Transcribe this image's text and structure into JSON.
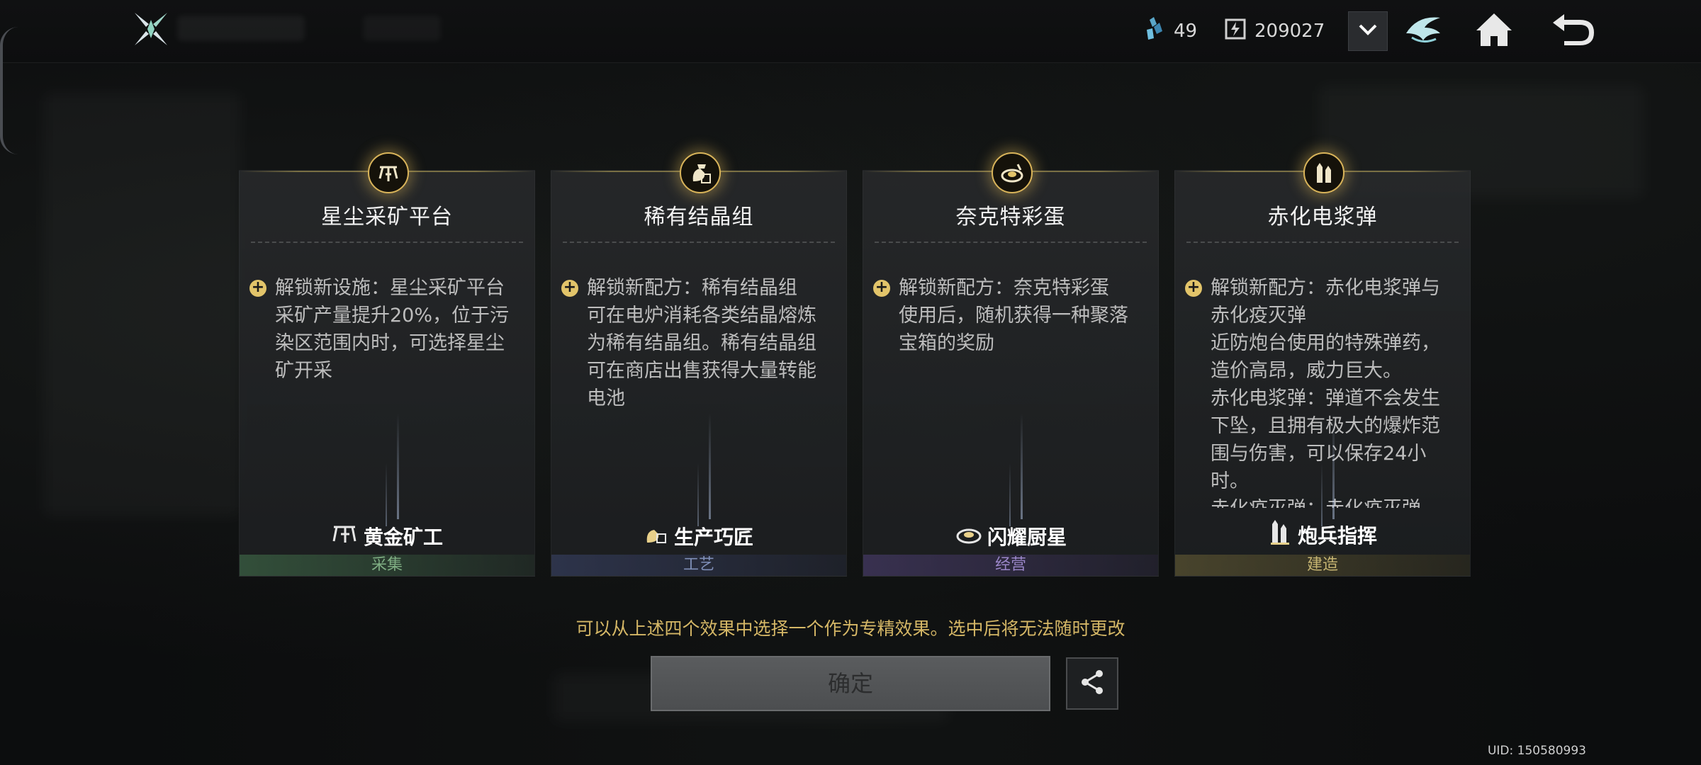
{
  "header": {
    "resources": [
      {
        "icon": "crystal-shard-icon",
        "value": "49"
      },
      {
        "icon": "energy-cell-icon",
        "value": "209027"
      }
    ]
  },
  "cards": [
    {
      "icon": "mining-platform-icon",
      "title": "星尘采矿平台",
      "description": [
        "解锁新设施：星尘采矿平台",
        "采矿产量提升20%，位于污染区范围内时，可选择星尘矿开采"
      ],
      "subtitle": "黄金矿工",
      "subtitle_icon": "mining-platform-icon",
      "category": "采集",
      "accent": "#7fae83"
    },
    {
      "icon": "crystal-cluster-icon",
      "title": "稀有结晶组",
      "description": [
        "解锁新配方：稀有结晶组",
        "可在电炉消耗各类结晶熔炼为稀有结晶组。稀有结晶组可在商店出售获得大量转能电池"
      ],
      "subtitle": "生产巧匠",
      "subtitle_icon": "crystal-cluster-icon",
      "category": "工艺",
      "accent": "#7f8fb8"
    },
    {
      "icon": "egg-dish-icon",
      "title": "奈克特彩蛋",
      "description": [
        "解锁新配方：奈克特彩蛋",
        "使用后，随机获得一种聚落宝箱的奖励"
      ],
      "subtitle": "闪耀厨星",
      "subtitle_icon": "egg-dish-icon",
      "category": "经营",
      "accent": "#9a86c8"
    },
    {
      "icon": "plasma-shell-icon",
      "title": "赤化电浆弹",
      "description": [
        "解锁新配方：赤化电浆弹与赤化疫灭弹",
        "近防炮台使用的特殊弹药，造价高昂，威力巨大。",
        "赤化电浆弹：弹道不会发生下坠，且拥有极大的爆炸范围与伤害，可以保存24小时。",
        "赤化疫灭弹：赤化疫灭弹"
      ],
      "subtitle": "炮兵指挥",
      "subtitle_icon": "plasma-shell-icon",
      "category": "建造",
      "accent": "#c7b572"
    }
  ],
  "hint": "可以从上述四个效果中选择一个作为专精效果。选中后将无法随时更改",
  "confirm_label": "确定",
  "uid": "UID: 150580993",
  "colors": {
    "hint": "#d5b766",
    "emblem_glow": "#d9b45a"
  }
}
